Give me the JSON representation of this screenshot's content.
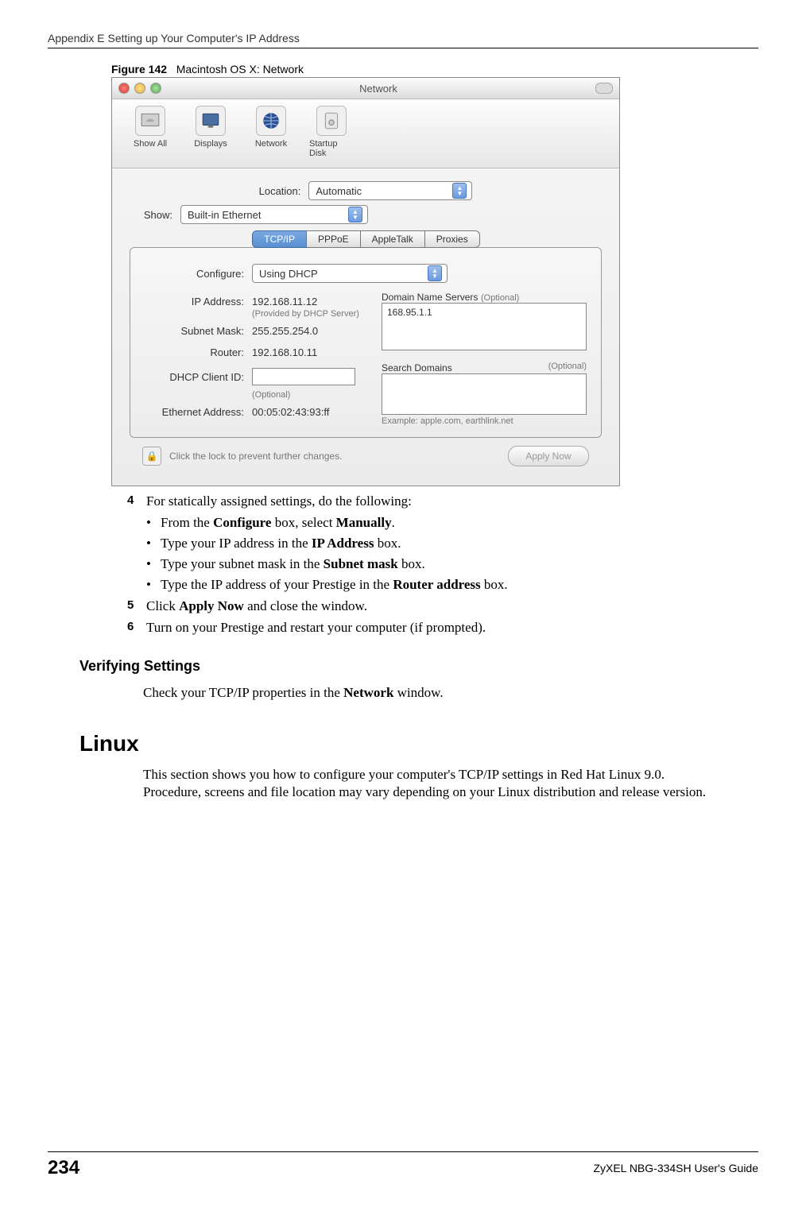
{
  "header": "Appendix E Setting up Your Computer's IP Address",
  "figure": {
    "label": "Figure 142",
    "caption": "Macintosh OS X: Network"
  },
  "window": {
    "title": "Network",
    "toolbar": [
      {
        "name": "show-all",
        "label": "Show All"
      },
      {
        "name": "displays",
        "label": "Displays"
      },
      {
        "name": "network",
        "label": "Network"
      },
      {
        "name": "startup-disk",
        "label": "Startup Disk"
      }
    ],
    "location_label": "Location:",
    "location_value": "Automatic",
    "show_label": "Show:",
    "show_value": "Built-in Ethernet",
    "tabs": [
      "TCP/IP",
      "PPPoE",
      "AppleTalk",
      "Proxies"
    ],
    "configure_label": "Configure:",
    "configure_value": "Using DHCP",
    "ip_label": "IP Address:",
    "ip_value": "192.168.11.12",
    "ip_note": "(Provided by DHCP Server)",
    "subnet_label": "Subnet Mask:",
    "subnet_value": "255.255.254.0",
    "router_label": "Router:",
    "router_value": "192.168.10.11",
    "dhcp_label": "DHCP Client ID:",
    "dhcp_note": "(Optional)",
    "eth_label": "Ethernet Address:",
    "eth_value": "00:05:02:43:93:ff",
    "dns_label": "Domain Name Servers",
    "dns_opt": "(Optional)",
    "dns_value": "168.95.1.1",
    "search_label": "Search Domains",
    "search_opt": "(Optional)",
    "search_example": "Example: apple.com, earthlink.net",
    "lock_text": "Click the lock to prevent further changes.",
    "apply_label": "Apply Now"
  },
  "steps": {
    "s4": "For statically assigned settings, do the following:",
    "b1_pre": "From the ",
    "b1_bold1": "Configure",
    "b1_mid": " box, select ",
    "b1_bold2": "Manually",
    "b1_post": ".",
    "b2_pre": "Type your IP address in the ",
    "b2_bold": "IP Address",
    "b2_post": " box.",
    "b3_pre": "Type your subnet mask in the ",
    "b3_bold": "Subnet mask",
    "b3_post": " box.",
    "b4_pre": "Type the IP address of your Prestige in the ",
    "b4_bold": "Router address",
    "b4_post": " box.",
    "s5_pre": "Click ",
    "s5_bold": "Apply Now",
    "s5_post": " and close the window.",
    "s6": "Turn on your Prestige and restart your computer (if prompted)."
  },
  "verifying": {
    "title": "Verifying Settings",
    "text_pre": "Check your TCP/IP properties in the ",
    "text_bold": "Network",
    "text_post": " window."
  },
  "linux": {
    "title": "Linux",
    "text": "This section shows you how to configure your computer's TCP/IP settings in Red Hat Linux 9.0. Procedure, screens and file location may vary depending on your Linux distribution and release version."
  },
  "footer": {
    "page": "234",
    "guide": "ZyXEL NBG-334SH User's Guide"
  },
  "nums": {
    "four": "4",
    "five": "5",
    "six": "6"
  },
  "bullets": {
    "dot": "•"
  }
}
